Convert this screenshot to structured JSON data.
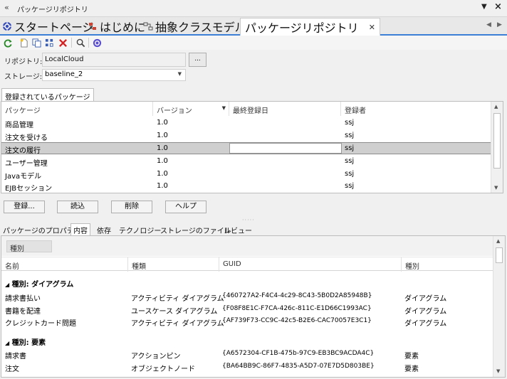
{
  "window": {
    "title": "パッケージリポジトリ"
  },
  "tabs": [
    {
      "label": "スタートページ"
    },
    {
      "label": "はじめに"
    },
    {
      "label": "抽象クラスモデル"
    },
    {
      "label": "パッケージリポジトリ"
    }
  ],
  "form": {
    "repository_label": "リポジトリ:",
    "repository_value": "LocalCloud",
    "browse_label": "...",
    "storage_label": "ストレージ:",
    "storage_value": "baseline_2"
  },
  "registered": {
    "section_label": "登録されているパッケージ",
    "columns": [
      "パッケージ",
      "バージョン",
      "最終登録日",
      "登録者"
    ],
    "rows": [
      {
        "package": "商品管理",
        "version": "1.0",
        "date": "",
        "user": "ssj"
      },
      {
        "package": "注文を受ける",
        "version": "1.0",
        "date": "",
        "user": "ssj"
      },
      {
        "package": "注文の履行",
        "version": "1.0",
        "date": "",
        "user": "ssj"
      },
      {
        "package": "ユーザー管理",
        "version": "1.0",
        "date": "",
        "user": "ssj"
      },
      {
        "package": "Javaモデル",
        "version": "1.0",
        "date": "",
        "user": "ssj"
      },
      {
        "package": "EJBセッション",
        "version": "1.0",
        "date": "",
        "user": "ssj"
      }
    ],
    "selected_row": "注文の履行"
  },
  "buttons": {
    "register": "登録...",
    "load": "読込",
    "delete": "削除",
    "help": "ヘルプ"
  },
  "subtabs": [
    "パッケージのプロパティ",
    "内容",
    "依存",
    "テクノロジー",
    "ストレージのファイル",
    "レビュー"
  ],
  "contents": {
    "group_chip": "種別",
    "columns": [
      "名前",
      "種類",
      "GUID",
      "種別"
    ],
    "groups": [
      {
        "title": "種別: ダイアグラム",
        "items": [
          {
            "name": "請求書払い",
            "kind": "アクティビティ ダイアグラム",
            "guid": "{460727A2-F4C4-4c29-8C43-5B0D2A85948B}",
            "type": "ダイアグラム"
          },
          {
            "name": "書籍を配達",
            "kind": "ユースケース ダイアグラム",
            "guid": "{F08F8E1C-F7CA-426c-811C-E1D66C1993AC}",
            "type": "ダイアグラム"
          },
          {
            "name": "クレジットカード問題",
            "kind": "アクティビティ ダイアグラム",
            "guid": "{AF739F73-CC9C-42c5-B2E6-CAC70057E3C1}",
            "type": "ダイアグラム"
          }
        ]
      },
      {
        "title": "種別: 要素",
        "items": [
          {
            "name": "請求書",
            "kind": "アクションピン",
            "guid": "{A6572304-CF1B-475b-97C9-EB3BC9ACDA4C}",
            "type": "要素"
          },
          {
            "name": "注文",
            "kind": "オブジェクトノード",
            "guid": "{BA64BB9C-86F7-4835-A5D7-07E7D5D803BE}",
            "type": "要素"
          }
        ]
      }
    ]
  }
}
